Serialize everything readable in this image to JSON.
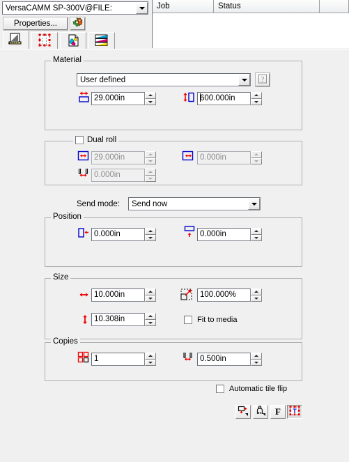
{
  "printer": {
    "selected": "VersaCAMM SP-300V@FILE:",
    "properties_label": "Properties...",
    "gear_icon": "gear-icon",
    "dropdown_icon": "chevron-down-icon"
  },
  "tabs": [
    {
      "name": "tab-layout",
      "icon": "page-layout-icon",
      "active": true
    },
    {
      "name": "tab-cut",
      "icon": "cut-contour-icon",
      "active": false
    },
    {
      "name": "tab-color",
      "icon": "color-document-icon",
      "active": false
    },
    {
      "name": "tab-ink",
      "icon": "ink-bars-icon",
      "active": false
    }
  ],
  "joblist": {
    "columns": [
      "Job",
      "Status",
      ""
    ],
    "rows": []
  },
  "material": {
    "legend": "Material",
    "preset": "User defined",
    "help_icon": "help-question-icon",
    "width": {
      "icon": "material-width-icon",
      "value": "29.000in"
    },
    "height": {
      "icon": "material-height-icon",
      "value": "600.000in",
      "caret_before": true
    }
  },
  "dual_roll": {
    "legend": "Dual roll",
    "checked": false,
    "enabled": false,
    "left_width": {
      "icon": "dualroll-left-width-icon",
      "value": "29.000in"
    },
    "right_width": {
      "icon": "dualroll-right-width-icon",
      "value": "0.000in"
    },
    "gap": {
      "icon": "dualroll-gap-icon",
      "value": "0.000in"
    }
  },
  "send_mode": {
    "label": "Send mode:",
    "value": "Send now",
    "dropdown_icon": "chevron-down-icon"
  },
  "position": {
    "legend": "Position",
    "x": {
      "icon": "position-left-icon",
      "value": "0.000in"
    },
    "y": {
      "icon": "position-top-icon",
      "value": "0.000in"
    }
  },
  "size": {
    "legend": "Size",
    "width": {
      "icon": "size-width-icon",
      "value": "10.000in"
    },
    "height": {
      "icon": "size-height-icon",
      "value": "10.308in"
    },
    "scale": {
      "icon": "scale-icon",
      "value": "100.000%"
    },
    "fit_to_media": {
      "label": "Fit to media",
      "checked": false
    }
  },
  "copies": {
    "legend": "Copies",
    "count": {
      "icon": "copies-grid-icon",
      "value": "1"
    },
    "spacing": {
      "icon": "copies-spacing-icon",
      "value": "0.500in"
    }
  },
  "automatic_tile_flip": {
    "label": "Automatic tile flip",
    "checked": false
  },
  "bottom_buttons": [
    {
      "name": "nesting-button",
      "icon": "nesting-icon",
      "label": "",
      "pressed": false
    },
    {
      "name": "orientation-button",
      "icon": "figure-orientation-icon",
      "label": "",
      "pressed": false
    },
    {
      "name": "mirror-button",
      "icon": "letter-f-icon",
      "label": "F",
      "pressed": false
    },
    {
      "name": "crop-marks-button",
      "icon": "crop-marks-icon",
      "label": "",
      "pressed": true
    }
  ],
  "colors": {
    "accent_red": "#ee0000",
    "accent_blue": "#0000cc",
    "face": "#f0f0f0",
    "field": "#ffffff"
  }
}
